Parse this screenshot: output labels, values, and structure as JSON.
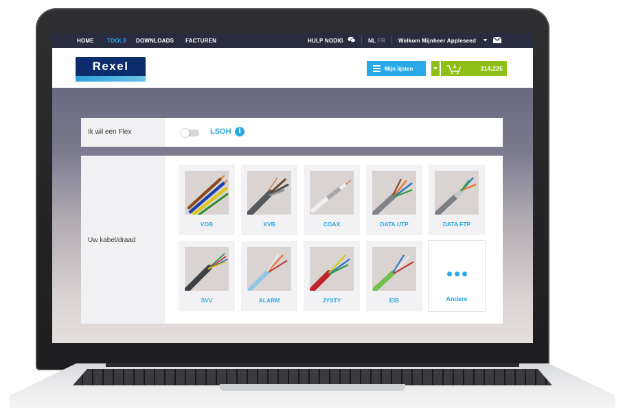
{
  "nav": {
    "home": "HOME",
    "tools": "TOOLS",
    "downloads": "DOWNLOADS",
    "invoices": "FACTUREN",
    "help": "HULP NODIG",
    "lang_nl": "NL",
    "lang_fr": "FR",
    "welcome": "Welkom Mijnheer Appleseed",
    "active_color": "#2aa9e8"
  },
  "header": {
    "logo_text": "Rexel",
    "lists_button": "Mijn lijsten",
    "cart_total": "314,22€",
    "brand_color": "#0c2c6b",
    "cart_color": "#8dbf16"
  },
  "flex": {
    "label": "Ik wil een Flex",
    "toggle_on": false,
    "tag": "LSOH",
    "info_glyph": "i"
  },
  "cables": {
    "label": "Uw kabel/draad",
    "items": [
      {
        "name": "VOB",
        "icon": "vob-cable-photo"
      },
      {
        "name": "XVB",
        "icon": "xvb-cable-photo"
      },
      {
        "name": "COAX",
        "icon": "coax-cable-photo"
      },
      {
        "name": "DATA UTP",
        "icon": "data-utp-cable-photo"
      },
      {
        "name": "DATA FTP",
        "icon": "data-ftp-cable-photo"
      },
      {
        "name": "SVV",
        "icon": "svv-cable-photo"
      },
      {
        "name": "ALARM",
        "icon": "alarm-cable-photo"
      },
      {
        "name": "JYSTY",
        "icon": "jysty-cable-photo"
      },
      {
        "name": "EIB",
        "icon": "eib-cable-photo"
      },
      {
        "name": "Andere",
        "icon": "more-dots-icon"
      }
    ]
  }
}
